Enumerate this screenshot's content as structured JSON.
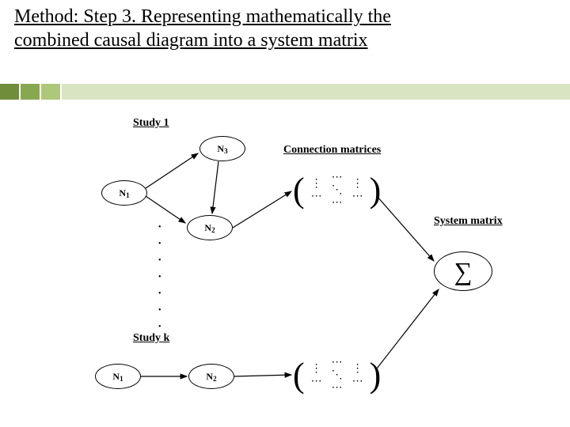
{
  "title": "Method: Step 3. Representing mathematically the combined causal diagram into a system matrix",
  "labels": {
    "study1": "Study 1",
    "studyk": "Study k",
    "connection": "Connection matrices",
    "system": "System matrix"
  },
  "nodes": {
    "n1a": "N",
    "n1a_sub": "1",
    "n2a": "N",
    "n2a_sub": "2",
    "n3a": "N",
    "n3a_sub": "3",
    "n1b": "N",
    "n1b_sub": "1",
    "n2b": "N",
    "n2b_sub": "2",
    "sigma": "∑"
  },
  "matrix_glyphs": {
    "vdots": "⋮",
    "ddots": "⋱",
    "cdots": "⋯"
  }
}
